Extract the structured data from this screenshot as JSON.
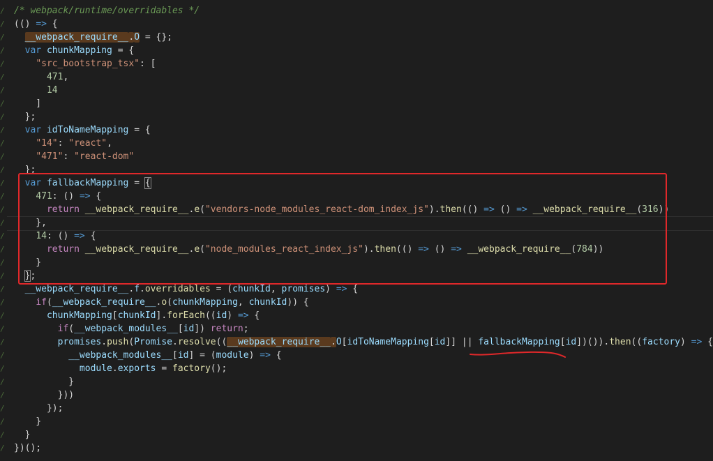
{
  "gutter": {
    "mark": "/"
  },
  "code_lines": [
    [
      {
        "t": "/* webpack/runtime/overridables */",
        "c": "c-comment"
      }
    ],
    [
      {
        "t": "(() ",
        "c": "c-plain"
      },
      {
        "t": "=>",
        "c": "c-kw"
      },
      {
        "t": " {",
        "c": "c-plain"
      }
    ],
    [
      {
        "t": "  ",
        "c": "c-plain"
      },
      {
        "t": "__webpack_require__",
        "c": "c-var",
        "hl": true
      },
      {
        "t": ".",
        "c": "c-plain",
        "hl": true
      },
      {
        "t": "O",
        "c": "c-var",
        "hl": true
      },
      {
        "t": " = {};",
        "c": "c-plain"
      }
    ],
    [
      {
        "t": "  ",
        "c": "c-plain"
      },
      {
        "t": "var",
        "c": "c-kw"
      },
      {
        "t": " ",
        "c": "c-plain"
      },
      {
        "t": "chunkMapping",
        "c": "c-var"
      },
      {
        "t": " = {",
        "c": "c-plain"
      }
    ],
    [
      {
        "t": "    ",
        "c": "c-plain"
      },
      {
        "t": "\"src_bootstrap_tsx\"",
        "c": "c-str"
      },
      {
        "t": ": [",
        "c": "c-plain"
      }
    ],
    [
      {
        "t": "      ",
        "c": "c-plain"
      },
      {
        "t": "471",
        "c": "c-num"
      },
      {
        "t": ",",
        "c": "c-plain"
      }
    ],
    [
      {
        "t": "      ",
        "c": "c-plain"
      },
      {
        "t": "14",
        "c": "c-num"
      }
    ],
    [
      {
        "t": "    ]",
        "c": "c-plain"
      }
    ],
    [
      {
        "t": "  };",
        "c": "c-plain"
      }
    ],
    [
      {
        "t": "  ",
        "c": "c-plain"
      },
      {
        "t": "var",
        "c": "c-kw"
      },
      {
        "t": " ",
        "c": "c-plain"
      },
      {
        "t": "idToNameMapping",
        "c": "c-var"
      },
      {
        "t": " = {",
        "c": "c-plain"
      }
    ],
    [
      {
        "t": "    ",
        "c": "c-plain"
      },
      {
        "t": "\"14\"",
        "c": "c-str"
      },
      {
        "t": ": ",
        "c": "c-plain"
      },
      {
        "t": "\"react\"",
        "c": "c-str"
      },
      {
        "t": ",",
        "c": "c-plain"
      }
    ],
    [
      {
        "t": "    ",
        "c": "c-plain"
      },
      {
        "t": "\"471\"",
        "c": "c-str"
      },
      {
        "t": ": ",
        "c": "c-plain"
      },
      {
        "t": "\"react-dom\"",
        "c": "c-str"
      }
    ],
    [
      {
        "t": "  };",
        "c": "c-plain"
      }
    ],
    [
      {
        "t": "  ",
        "c": "c-plain"
      },
      {
        "t": "var",
        "c": "c-kw"
      },
      {
        "t": " ",
        "c": "c-plain"
      },
      {
        "t": "fallbackMapping",
        "c": "c-var"
      },
      {
        "t": " = ",
        "c": "c-plain"
      },
      {
        "t": "{",
        "c": "c-plain",
        "box": true
      }
    ],
    [
      {
        "t": "    ",
        "c": "c-plain"
      },
      {
        "t": "471",
        "c": "c-num"
      },
      {
        "t": ": () ",
        "c": "c-plain"
      },
      {
        "t": "=>",
        "c": "c-kw"
      },
      {
        "t": " {",
        "c": "c-plain"
      }
    ],
    [
      {
        "t": "      ",
        "c": "c-plain"
      },
      {
        "t": "return",
        "c": "c-kw2"
      },
      {
        "t": " ",
        "c": "c-plain"
      },
      {
        "t": "__webpack_require__",
        "c": "c-fn"
      },
      {
        "t": ".",
        "c": "c-plain"
      },
      {
        "t": "e",
        "c": "c-fn"
      },
      {
        "t": "(",
        "c": "c-plain"
      },
      {
        "t": "\"vendors-node_modules_react-dom_index_js\"",
        "c": "c-str"
      },
      {
        "t": ").",
        "c": "c-plain"
      },
      {
        "t": "then",
        "c": "c-fn"
      },
      {
        "t": "(() ",
        "c": "c-plain"
      },
      {
        "t": "=>",
        "c": "c-kw"
      },
      {
        "t": " () ",
        "c": "c-plain"
      },
      {
        "t": "=>",
        "c": "c-kw"
      },
      {
        "t": " ",
        "c": "c-plain"
      },
      {
        "t": "__webpack_require__",
        "c": "c-fn"
      },
      {
        "t": "(",
        "c": "c-plain"
      },
      {
        "t": "316",
        "c": "c-num"
      },
      {
        "t": "))",
        "c": "c-plain"
      }
    ],
    [
      {
        "t": "    },",
        "c": "c-plain"
      }
    ],
    [
      {
        "t": "    ",
        "c": "c-plain"
      },
      {
        "t": "14",
        "c": "c-num"
      },
      {
        "t": ": () ",
        "c": "c-plain"
      },
      {
        "t": "=>",
        "c": "c-kw"
      },
      {
        "t": " {",
        "c": "c-plain"
      }
    ],
    [
      {
        "t": "      ",
        "c": "c-plain"
      },
      {
        "t": "return",
        "c": "c-kw2"
      },
      {
        "t": " ",
        "c": "c-plain"
      },
      {
        "t": "__webpack_require__",
        "c": "c-fn"
      },
      {
        "t": ".",
        "c": "c-plain"
      },
      {
        "t": "e",
        "c": "c-fn"
      },
      {
        "t": "(",
        "c": "c-plain"
      },
      {
        "t": "\"node_modules_react_index_js\"",
        "c": "c-str"
      },
      {
        "t": ").",
        "c": "c-plain"
      },
      {
        "t": "then",
        "c": "c-fn"
      },
      {
        "t": "(() ",
        "c": "c-plain"
      },
      {
        "t": "=>",
        "c": "c-kw"
      },
      {
        "t": " () ",
        "c": "c-plain"
      },
      {
        "t": "=>",
        "c": "c-kw"
      },
      {
        "t": " ",
        "c": "c-plain"
      },
      {
        "t": "__webpack_require__",
        "c": "c-fn"
      },
      {
        "t": "(",
        "c": "c-plain"
      },
      {
        "t": "784",
        "c": "c-num"
      },
      {
        "t": "))",
        "c": "c-plain"
      }
    ],
    [
      {
        "t": "    }",
        "c": "c-plain"
      }
    ],
    [
      {
        "t": "  ",
        "c": "c-plain"
      },
      {
        "t": "}",
        "c": "c-plain",
        "box": true
      },
      {
        "t": ";",
        "c": "c-plain"
      }
    ],
    [
      {
        "t": "  ",
        "c": "c-plain"
      },
      {
        "t": "__webpack_require__",
        "c": "c-var"
      },
      {
        "t": ".",
        "c": "c-plain"
      },
      {
        "t": "f",
        "c": "c-var"
      },
      {
        "t": ".",
        "c": "c-plain"
      },
      {
        "t": "overridables",
        "c": "c-fn"
      },
      {
        "t": " = (",
        "c": "c-plain"
      },
      {
        "t": "chunkId",
        "c": "c-var"
      },
      {
        "t": ", ",
        "c": "c-plain"
      },
      {
        "t": "promises",
        "c": "c-var"
      },
      {
        "t": ") ",
        "c": "c-plain"
      },
      {
        "t": "=>",
        "c": "c-kw"
      },
      {
        "t": " {",
        "c": "c-plain"
      }
    ],
    [
      {
        "t": "    ",
        "c": "c-plain"
      },
      {
        "t": "if",
        "c": "c-kw2"
      },
      {
        "t": "(",
        "c": "c-plain"
      },
      {
        "t": "__webpack_require__",
        "c": "c-var"
      },
      {
        "t": ".",
        "c": "c-plain"
      },
      {
        "t": "o",
        "c": "c-fn"
      },
      {
        "t": "(",
        "c": "c-plain"
      },
      {
        "t": "chunkMapping",
        "c": "c-var"
      },
      {
        "t": ", ",
        "c": "c-plain"
      },
      {
        "t": "chunkId",
        "c": "c-var"
      },
      {
        "t": ")) {",
        "c": "c-plain"
      }
    ],
    [
      {
        "t": "      ",
        "c": "c-plain"
      },
      {
        "t": "chunkMapping",
        "c": "c-var"
      },
      {
        "t": "[",
        "c": "c-plain"
      },
      {
        "t": "chunkId",
        "c": "c-var"
      },
      {
        "t": "].",
        "c": "c-plain"
      },
      {
        "t": "forEach",
        "c": "c-fn"
      },
      {
        "t": "((",
        "c": "c-plain"
      },
      {
        "t": "id",
        "c": "c-var"
      },
      {
        "t": ") ",
        "c": "c-plain"
      },
      {
        "t": "=>",
        "c": "c-kw"
      },
      {
        "t": " {",
        "c": "c-plain"
      }
    ],
    [
      {
        "t": "        ",
        "c": "c-plain"
      },
      {
        "t": "if",
        "c": "c-kw2"
      },
      {
        "t": "(",
        "c": "c-plain"
      },
      {
        "t": "__webpack_modules__",
        "c": "c-var"
      },
      {
        "t": "[",
        "c": "c-plain"
      },
      {
        "t": "id",
        "c": "c-var"
      },
      {
        "t": "]) ",
        "c": "c-plain"
      },
      {
        "t": "return",
        "c": "c-kw2"
      },
      {
        "t": ";",
        "c": "c-plain"
      }
    ],
    [
      {
        "t": "        ",
        "c": "c-plain"
      },
      {
        "t": "promises",
        "c": "c-var"
      },
      {
        "t": ".",
        "c": "c-plain"
      },
      {
        "t": "push",
        "c": "c-fn"
      },
      {
        "t": "(",
        "c": "c-plain"
      },
      {
        "t": "Promise",
        "c": "c-var"
      },
      {
        "t": ".",
        "c": "c-plain"
      },
      {
        "t": "resolve",
        "c": "c-fn"
      },
      {
        "t": "((",
        "c": "c-plain"
      },
      {
        "t": "__webpack_require__",
        "c": "c-var",
        "hl": true
      },
      {
        "t": ".",
        "c": "c-plain",
        "hl": true
      },
      {
        "t": "O",
        "c": "c-var"
      },
      {
        "t": "[",
        "c": "c-plain"
      },
      {
        "t": "idToNameMapping",
        "c": "c-var"
      },
      {
        "t": "[",
        "c": "c-plain"
      },
      {
        "t": "id",
        "c": "c-var"
      },
      {
        "t": "]] || ",
        "c": "c-plain"
      },
      {
        "t": "fallbackMapping",
        "c": "c-var"
      },
      {
        "t": "[",
        "c": "c-plain"
      },
      {
        "t": "id",
        "c": "c-var"
      },
      {
        "t": "])()).",
        "c": "c-plain"
      },
      {
        "t": "then",
        "c": "c-fn"
      },
      {
        "t": "((",
        "c": "c-plain"
      },
      {
        "t": "factory",
        "c": "c-var"
      },
      {
        "t": ") ",
        "c": "c-plain"
      },
      {
        "t": "=>",
        "c": "c-kw"
      },
      {
        "t": " {",
        "c": "c-plain"
      }
    ],
    [
      {
        "t": "          ",
        "c": "c-plain"
      },
      {
        "t": "__webpack_modules__",
        "c": "c-var"
      },
      {
        "t": "[",
        "c": "c-plain"
      },
      {
        "t": "id",
        "c": "c-var"
      },
      {
        "t": "] = (",
        "c": "c-plain"
      },
      {
        "t": "module",
        "c": "c-var"
      },
      {
        "t": ") ",
        "c": "c-plain"
      },
      {
        "t": "=>",
        "c": "c-kw"
      },
      {
        "t": " {",
        "c": "c-plain"
      }
    ],
    [
      {
        "t": "            ",
        "c": "c-plain"
      },
      {
        "t": "module",
        "c": "c-var"
      },
      {
        "t": ".",
        "c": "c-plain"
      },
      {
        "t": "exports",
        "c": "c-var"
      },
      {
        "t": " = ",
        "c": "c-plain"
      },
      {
        "t": "factory",
        "c": "c-fn"
      },
      {
        "t": "();",
        "c": "c-plain"
      }
    ],
    [
      {
        "t": "          }",
        "c": "c-plain"
      }
    ],
    [
      {
        "t": "        }))",
        "c": "c-plain"
      }
    ],
    [
      {
        "t": "      });",
        "c": "c-plain"
      }
    ],
    [
      {
        "t": "    }",
        "c": "c-plain"
      }
    ],
    [
      {
        "t": "  }",
        "c": "c-plain"
      }
    ],
    [
      {
        "t": "})();",
        "c": "c-plain"
      }
    ]
  ],
  "colors": {
    "background": "#1e1e1e",
    "annotation_red": "#e0282a",
    "highlight": "#5a3a1e"
  }
}
